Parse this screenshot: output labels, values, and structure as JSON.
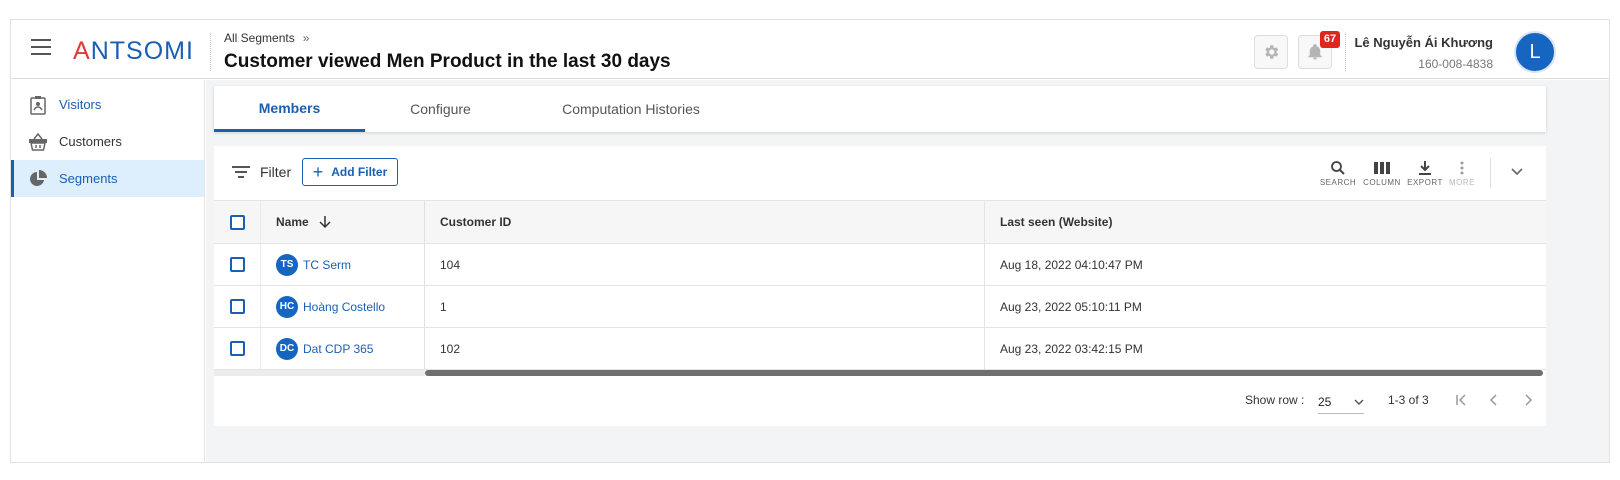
{
  "header": {
    "logo_text": "ANTSOMI",
    "breadcrumb": "All Segments",
    "breadcrumb_sep": "»",
    "title": "Customer viewed Men Product in the last 30 days",
    "notification_count": "67",
    "user_name": "Lê Nguyễn Ái Khương",
    "user_id": "160-008-4838",
    "avatar_letter": "L",
    "icons": [
      "menu-icon",
      "gear-icon",
      "bell-icon"
    ]
  },
  "sidebar": {
    "items": [
      {
        "label": "Visitors",
        "icon": "visitor-icon",
        "active": false
      },
      {
        "label": "Customers",
        "icon": "basket-icon",
        "active": false
      },
      {
        "label": "Segments",
        "icon": "pie-chart-icon",
        "active": true
      }
    ]
  },
  "tabs": [
    {
      "label": "Members",
      "active": true
    },
    {
      "label": "Configure",
      "active": false
    },
    {
      "label": "Computation Histories",
      "active": false
    }
  ],
  "toolbar": {
    "filter_label": "Filter",
    "add_filter_label": "Add Filter",
    "tools": [
      {
        "label": "SEARCH",
        "icon": "search-icon"
      },
      {
        "label": "COLUMN",
        "icon": "columns-icon"
      },
      {
        "label": "EXPORT",
        "icon": "download-icon"
      },
      {
        "label": "MORE",
        "icon": "more-vert-icon"
      }
    ]
  },
  "table": {
    "columns": [
      "Name",
      "Customer ID",
      "Last seen (Website)"
    ],
    "rows": [
      {
        "initials": "TS",
        "name": "TC Serm",
        "customer_id": "104",
        "last_seen": "Aug 18, 2022 04:10:47 PM"
      },
      {
        "initials": "HC",
        "name": "Hoàng Costello",
        "customer_id": "1",
        "last_seen": "Aug 23, 2022 05:10:11 PM"
      },
      {
        "initials": "DC",
        "name": "Dat CDP 365",
        "customer_id": "102",
        "last_seen": "Aug 23, 2022 03:42:15 PM"
      }
    ]
  },
  "pager": {
    "show_row_label": "Show row :",
    "rows_per_page": "25",
    "range": "1-3 of 3"
  },
  "colors": {
    "brand_blue": "#1a5fb4",
    "avatar_blue": "#1665c0",
    "badge_red": "#e0251c",
    "active_bg": "#ddeefc"
  }
}
